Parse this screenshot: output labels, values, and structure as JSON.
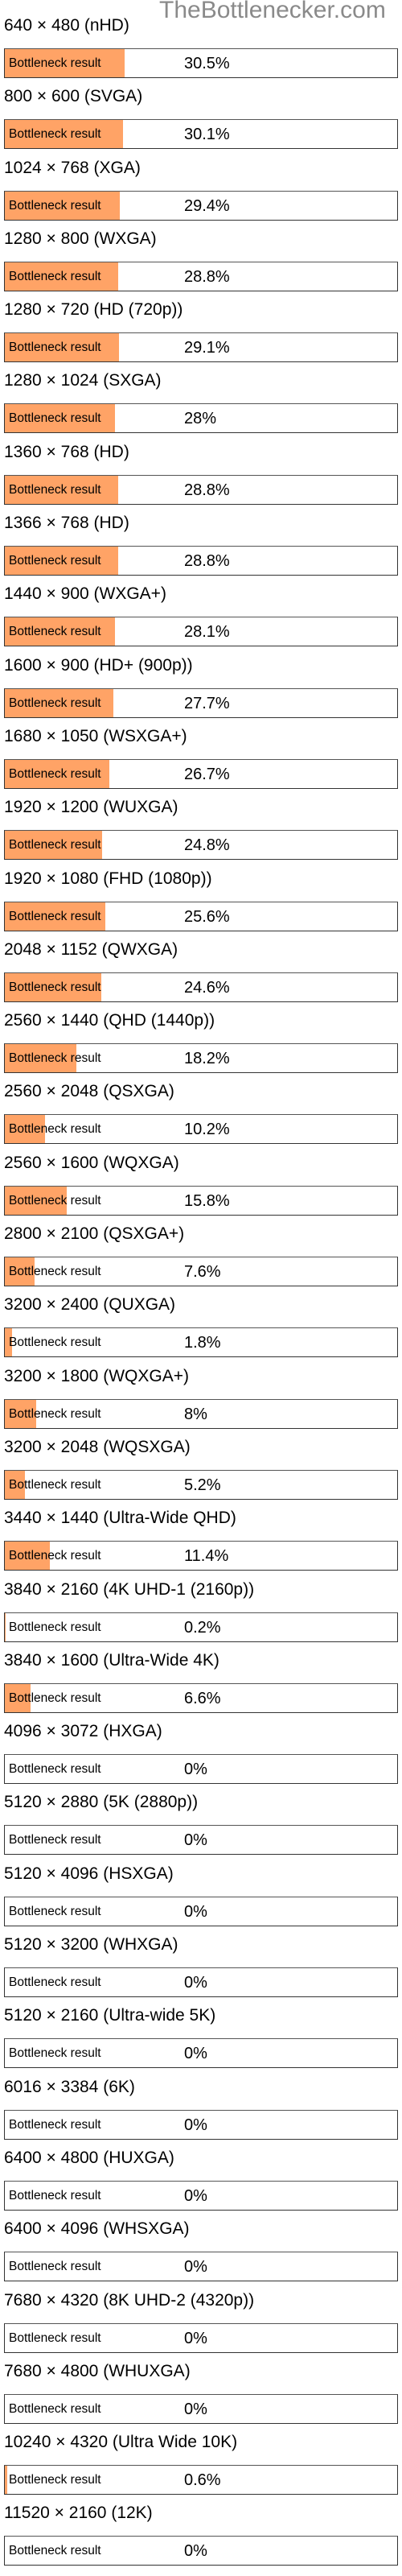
{
  "watermark": "TheBottlenecker.com",
  "bar_label": "Bottleneck result",
  "fill_color": "#ffa366",
  "chart_data": {
    "type": "bar",
    "orientation": "horizontal",
    "title": "",
    "xlabel": "",
    "ylabel": "",
    "xlim": [
      0,
      100
    ],
    "unit": "%",
    "categories": [
      "640 × 480 (nHD)",
      "800 × 600 (SVGA)",
      "1024 × 768 (XGA)",
      "1280 × 800 (WXGA)",
      "1280 × 720 (HD (720p))",
      "1280 × 1024 (SXGA)",
      "1360 × 768 (HD)",
      "1366 × 768 (HD)",
      "1440 × 900 (WXGA+)",
      "1600 × 900 (HD+ (900p))",
      "1680 × 1050 (WSXGA+)",
      "1920 × 1200 (WUXGA)",
      "1920 × 1080 (FHD (1080p))",
      "2048 × 1152 (QWXGA)",
      "2560 × 1440 (QHD (1440p))",
      "2560 × 2048 (QSXGA)",
      "2560 × 1600 (WQXGA)",
      "2800 × 2100 (QSXGA+)",
      "3200 × 2400 (QUXGA)",
      "3200 × 1800 (WQXGA+)",
      "3200 × 2048 (WQSXGA)",
      "3440 × 1440 (Ultra-Wide QHD)",
      "3840 × 2160 (4K UHD-1 (2160p))",
      "3840 × 1600 (Ultra-Wide 4K)",
      "4096 × 3072 (HXGA)",
      "5120 × 2880 (5K (2880p))",
      "5120 × 4096 (HSXGA)",
      "5120 × 3200 (WHXGA)",
      "5120 × 2160 (Ultra-wide 5K)",
      "6016 × 3384 (6K)",
      "6400 × 4800 (HUXGA)",
      "6400 × 4096 (WHSXGA)",
      "7680 × 4320 (8K UHD-2 (4320p))",
      "7680 × 4800 (WHUXGA)",
      "10240 × 4320 (Ultra Wide 10K)",
      "11520 × 2160 (12K)"
    ],
    "values": [
      30.5,
      30.1,
      29.4,
      28.8,
      29.1,
      28,
      28.8,
      28.8,
      28.1,
      27.7,
      26.7,
      24.8,
      25.6,
      24.6,
      18.2,
      10.2,
      15.8,
      7.6,
      1.8,
      8,
      5.2,
      11.4,
      0.2,
      6.6,
      0,
      0,
      0,
      0,
      0,
      0,
      0,
      0,
      0,
      0,
      0.6,
      0
    ],
    "value_labels": [
      "30.5%",
      "30.1%",
      "29.4%",
      "28.8%",
      "29.1%",
      "28%",
      "28.8%",
      "28.8%",
      "28.1%",
      "27.7%",
      "26.7%",
      "24.8%",
      "25.6%",
      "24.6%",
      "18.2%",
      "10.2%",
      "15.8%",
      "7.6%",
      "1.8%",
      "8%",
      "5.2%",
      "11.4%",
      "0.2%",
      "6.6%",
      "0%",
      "0%",
      "0%",
      "0%",
      "0%",
      "0%",
      "0%",
      "0%",
      "0%",
      "0%",
      "0.6%",
      "0%"
    ]
  }
}
